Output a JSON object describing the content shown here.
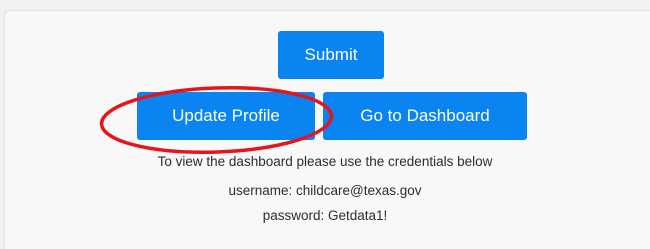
{
  "buttons": {
    "submit_label": "Submit",
    "update_profile_label": "Update Profile",
    "dashboard_label": "Go to Dashboard"
  },
  "info": {
    "instructions": "To view the dashboard please use the credentials below",
    "username_line": "username: childcare@texas.gov",
    "password_line": "password: Getdata1!"
  },
  "colors": {
    "button_bg": "#0a84f0",
    "annotation_ellipse": "#e4161b",
    "page_bg": "#f1f1f2"
  }
}
